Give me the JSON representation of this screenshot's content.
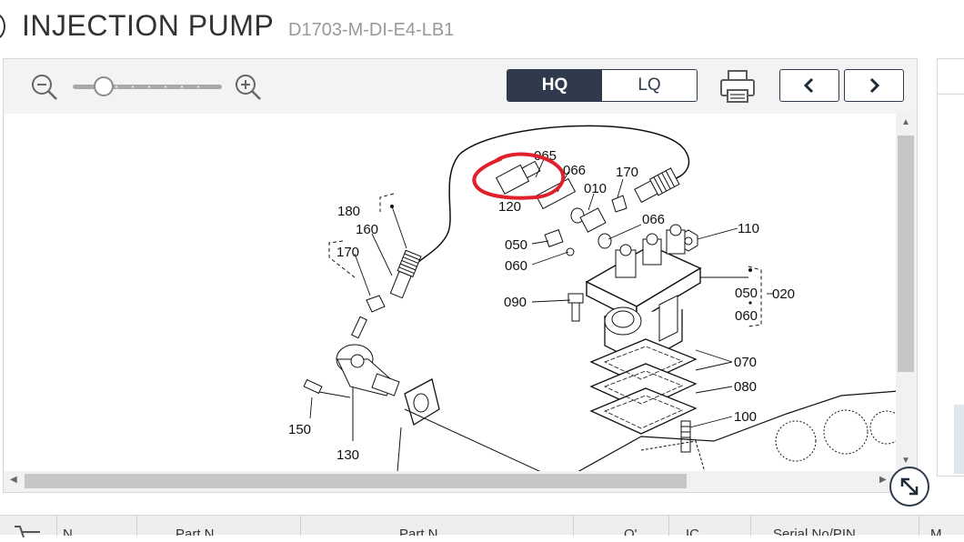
{
  "header": {
    "title": "INJECTION PUMP",
    "model": "D1703-M-DI-E4-LB1"
  },
  "toolbar": {
    "zoom_out_icon": "zoom-out-icon",
    "zoom_in_icon": "zoom-in-icon",
    "zoom_level": 0.12,
    "quality": {
      "hq_label": "HQ",
      "lq_label": "LQ",
      "selected": "HQ"
    },
    "print_icon": "printer-icon",
    "prev_icon": "chevron-left-icon",
    "next_icon": "chevron-right-icon"
  },
  "diagram": {
    "part_labels": [
      "065",
      "066",
      "170",
      "010",
      "120",
      "066",
      "180",
      "160",
      "170",
      "050",
      "060",
      "110",
      "090",
      "050",
      "020",
      "060",
      "070",
      "080",
      "100",
      "150",
      "130"
    ],
    "highlight_color": "#e0202a"
  },
  "scrollbar": {
    "vertical_position": 0.0,
    "horizontal_position": 0.0
  },
  "expand_icon": "expand-arrows-icon",
  "table": {
    "cart_icon": "cart-icon",
    "columns": [
      "N",
      "Part N",
      "Part N",
      "Q'",
      "IC",
      "Serial No/PIN",
      "M"
    ]
  },
  "colors": {
    "accent": "#2f3b4d",
    "highlight": "#e0202a"
  }
}
